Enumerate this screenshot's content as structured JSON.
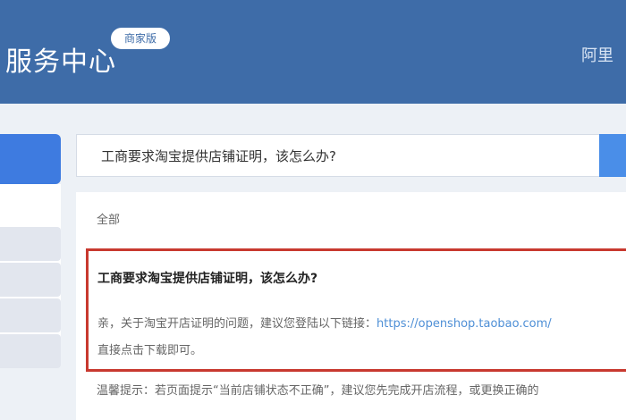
{
  "header": {
    "title": "服务中心",
    "badge": "商家版",
    "right_text": "阿里"
  },
  "search": {
    "query": "工商要求淘宝提供店铺证明，该怎么办?"
  },
  "content": {
    "tab_all": "全部",
    "answer": {
      "title": "工商要求淘宝提供店铺证明，该怎么办?",
      "line1_prefix": "亲，关于淘宝开店证明的问题，建议您登陆以下链接：",
      "link": "https://openshop.taobao.com/",
      "line2": "直接点击下载即可。"
    },
    "tip": "温馨提示：若页面提示“当前店铺状态不正确”，建议您先完成开店流程，或更换正确的"
  },
  "colors": {
    "header_bg": "#3e6ca8",
    "highlight_border": "#c8392f",
    "link": "#4e8fd6",
    "accent_blue": "#3e7be0"
  }
}
